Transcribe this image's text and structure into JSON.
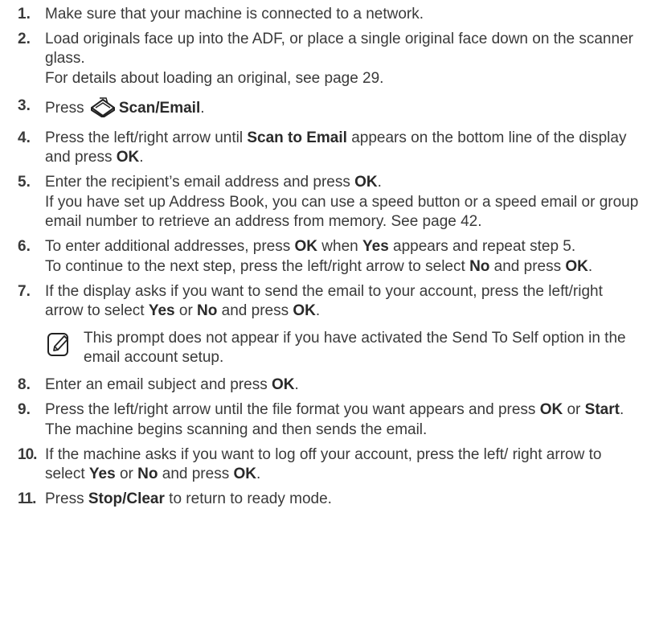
{
  "steps": [
    {
      "num": "1.",
      "line1": "Make sure that your machine is connected to a network."
    },
    {
      "num": "2.",
      "line1": "Load originals face up into the ADF, or place a single original face down on the scanner glass.",
      "line2": "For details about loading an original, see page 29."
    },
    {
      "num": "3.",
      "pre": "Press",
      "bold": "Scan/Email",
      "post": ".",
      "icon": "scan-email-icon"
    },
    {
      "num": "4.",
      "a": "Press the left/right arrow until ",
      "b": "Scan to Email",
      "c": " appears on the bottom line of the display and press ",
      "d": "OK",
      "e": "."
    },
    {
      "num": "5.",
      "a": "Enter the recipient’s email address and press ",
      "b": "OK",
      "c": ".",
      "line2": "If you have set up Address Book, you can use a speed button or a speed email or group email number to retrieve an address from memory. See page 42."
    },
    {
      "num": "6.",
      "a": "To enter additional addresses, press ",
      "b": "OK",
      "c": " when ",
      "d": "Yes",
      "e": " appears and repeat step 5.",
      "f": "To continue to the next step, press the left/right arrow to select ",
      "g": "No",
      "h": " and press ",
      "i": "OK",
      "j": "."
    },
    {
      "num": "7.",
      "a": "If the display asks if you want to send the email to your account, press the left/right arrow to select ",
      "b": "Yes",
      "c": " or ",
      "d": "No",
      "e": " and press ",
      "f": "OK",
      "g": "."
    },
    {
      "num": "8.",
      "a": "Enter an email subject and press ",
      "b": "OK",
      "c": "."
    },
    {
      "num": "9.",
      "a": "Press the left/right arrow until the file format you want appears and press ",
      "b": "OK",
      "c": " or ",
      "d": "Start",
      "e": ".",
      "line2": "The machine begins scanning and then sends the email."
    },
    {
      "num": "10.",
      "a": "If the machine asks if you want to log off your account, press the left/ right arrow to select ",
      "b": "Yes",
      "c": " or ",
      "d": "No",
      "e": " and press ",
      "f": "OK",
      "g": "."
    },
    {
      "num": "11.",
      "a": "Press ",
      "b": "Stop/Clear",
      "c": " to return to ready mode."
    }
  ],
  "note": {
    "icon": "note-pencil-icon",
    "text": "This prompt does not appear if you have activated the Send To Self option in the email account setup."
  }
}
